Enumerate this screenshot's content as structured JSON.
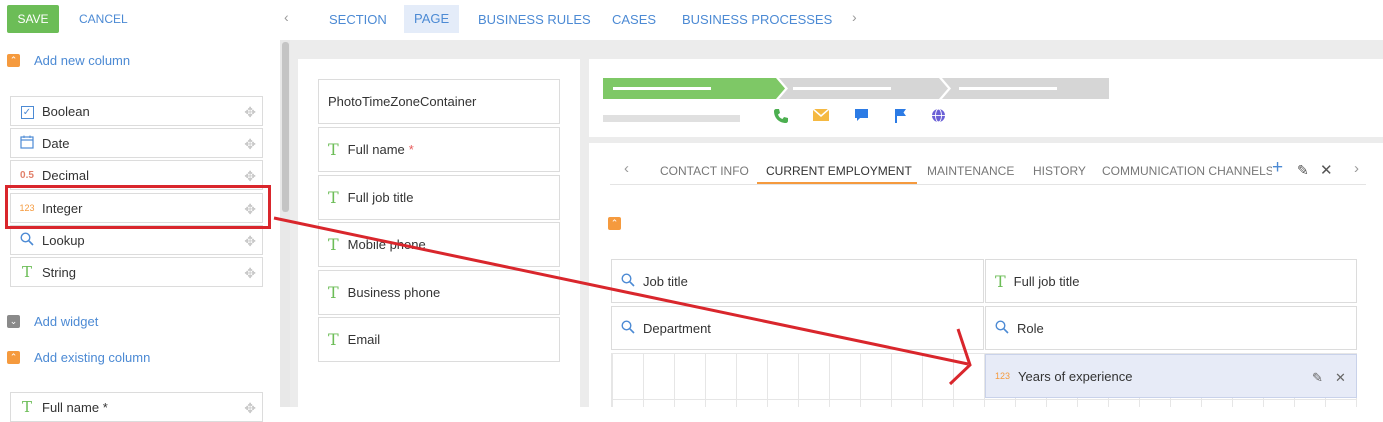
{
  "toolbar": {
    "save_label": "SAVE",
    "cancel_label": "CANCEL"
  },
  "top_tabs": [
    "SECTION",
    "PAGE",
    "BUSINESS RULES",
    "CASES",
    "BUSINESS PROCESSES"
  ],
  "active_top_tab": "PAGE",
  "left_panel": {
    "add_new_column": "Add new column",
    "column_types": [
      {
        "label": "Boolean",
        "icon": "checkbox-icon"
      },
      {
        "label": "Date",
        "icon": "calendar-icon"
      },
      {
        "label": "Decimal",
        "icon": "decimal-icon",
        "glyph": "0.5"
      },
      {
        "label": "Integer",
        "icon": "integer-icon",
        "glyph": "123"
      },
      {
        "label": "Lookup",
        "icon": "magnifier-icon"
      },
      {
        "label": "String",
        "icon": "text-t-icon",
        "glyph": "T"
      }
    ],
    "add_widget": "Add widget",
    "add_existing_column": "Add existing column",
    "existing_first": "Full name *"
  },
  "middle_fields": [
    {
      "label": "PhotoTimeZoneContainer",
      "icon": ""
    },
    {
      "label": "Full name",
      "icon": "T",
      "required": "*"
    },
    {
      "label": "Full job title",
      "icon": "T"
    },
    {
      "label": "Mobile phone",
      "icon": "T"
    },
    {
      "label": "Business phone",
      "icon": "T"
    },
    {
      "label": "Email",
      "icon": "T"
    }
  ],
  "detail_tabs": [
    "CONTACT INFO",
    "CURRENT EMPLOYMENT",
    "MAINTENANCE",
    "HISTORY",
    "COMMUNICATION CHANNELS"
  ],
  "active_detail_tab": "CURRENT EMPLOYMENT",
  "detail_fields": [
    {
      "label": "Job title",
      "icon": "magnifier-icon"
    },
    {
      "label": "Full job title",
      "icon": "T"
    },
    {
      "label": "Department",
      "icon": "magnifier-icon"
    },
    {
      "label": "Role",
      "icon": "magnifier-icon"
    },
    {
      "label": "Years of experience",
      "icon": "123"
    }
  ],
  "colors": {
    "accent_blue": "#4c8ad4",
    "save_green": "#6cbd57",
    "orange": "#f59a3e",
    "annotation_red": "#d9262c"
  }
}
